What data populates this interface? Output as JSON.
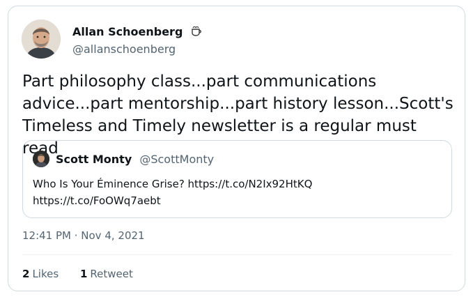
{
  "tweet": {
    "author": {
      "name": "Allan Schoenberg",
      "handle": "@allanschoenberg",
      "badge_icon": "coffee-cup-icon"
    },
    "text": "Part philosophy class...part communications advice...part mentorship...part history lesson...Scott's Timeless and Timely newsletter is a regular must read",
    "quoted": {
      "name": "Scott Monty",
      "handle": "@ScottMonty",
      "text_line1": "Who Is Your Éminence Grise? https://t.co/N2Ix92HtKQ",
      "text_line2": "https://t.co/FoOWq7aebt"
    },
    "timestamp": "12:41 PM · Nov 4, 2021",
    "stats": {
      "likes_count": "2",
      "likes_label": "Likes",
      "retweets_count": "1",
      "retweets_label": "Retweet"
    }
  },
  "colors": {
    "text_primary": "#0f1419",
    "text_secondary": "#536471",
    "border": "#cfd9de"
  }
}
